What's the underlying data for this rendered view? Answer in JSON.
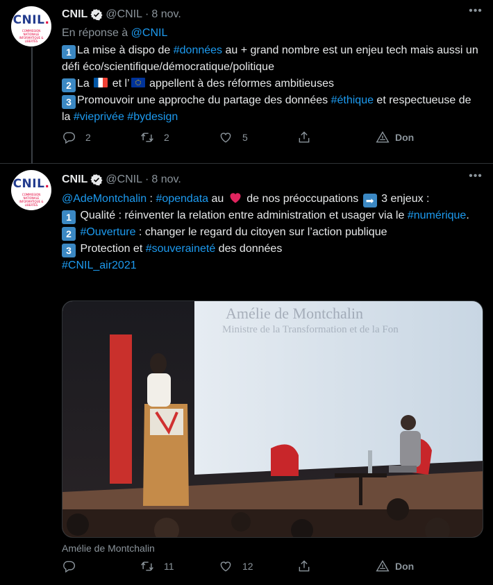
{
  "tweet1": {
    "author_name": "CNIL",
    "author_handle": "@CNIL",
    "separator": "·",
    "date": "8 nov.",
    "avatar_logo_text": "CNIL",
    "avatar_logo_dot": ".",
    "avatar_subtext": "COMMISSION NATIONALE INFORMATIQUE & LIBERTÉS",
    "reply_prefix": "En réponse à",
    "reply_handle": "@CNIL",
    "lines": {
      "l1_num": "1",
      "l1_a": "La mise à dispo de ",
      "l1_tag": "#données",
      "l1_b": " au + grand nombre est un enjeu tech mais aussi un défi éco/scientifique/démocratique/politique",
      "l2_num": "2",
      "l2_a": "La ",
      "l2_b": " et l’",
      "l2_c": " appellent à des réformes ambitieuses",
      "l3_num": "3",
      "l3_a": "Promouvoir une approche du partage des données ",
      "l3_tag1": "#éthique",
      "l3_b": " et respectueuse de la ",
      "l3_tag2": "#vieprivée",
      "l3_sp": " ",
      "l3_tag3": "#bydesign"
    },
    "actions": {
      "replies": "2",
      "retweets": "2",
      "likes": "5",
      "don": "Don"
    }
  },
  "tweet2": {
    "author_name": "CNIL",
    "author_handle": "@CNIL",
    "separator": "·",
    "date": "8 nov.",
    "avatar_logo_text": "CNIL",
    "avatar_logo_dot": ".",
    "avatar_subtext": "COMMISSION NATIONALE INFORMATIQUE & LIBERTÉS",
    "lines": {
      "l0_mention": "@AdeMontchalin",
      "l0_a": " : ",
      "l0_tag": "#opendata",
      "l0_b": " au ",
      "l0_c": " de nos préoccupations ",
      "l0_arrow": "➡",
      "l0_d": " 3 enjeux :",
      "l1_num": "1",
      "l1_a": " Qualité : réinventer la relation entre administration et usager via le ",
      "l1_tag": "#numérique",
      "l1_b": ".",
      "l2_num": "2",
      "l2_tag": " #Ouverture",
      "l2_a": " : changer le regard du citoyen sur l’action publique",
      "l3_num": "3",
      "l3_a": " Protection et ",
      "l3_tag": "#souveraineté",
      "l3_b": " des données",
      "l4_tag": "#CNIL_air2021"
    },
    "media": {
      "screen_text_1": "Amélie de Montchalin",
      "screen_text_2": "Ministre de la Transformation et de la Fon"
    },
    "caption": "Amélie de Montchalin",
    "actions": {
      "replies": "",
      "retweets": "11",
      "likes": "12",
      "don": "Don"
    }
  },
  "colors": {
    "accent": "#1d9bf0",
    "background": "#000000",
    "muted": "#8b949b",
    "text": "#e7e9ea"
  },
  "icons": [
    "verified-badge-icon",
    "more-icon",
    "reply-icon",
    "retweet-icon",
    "like-icon",
    "share-icon",
    "donate-icon"
  ]
}
